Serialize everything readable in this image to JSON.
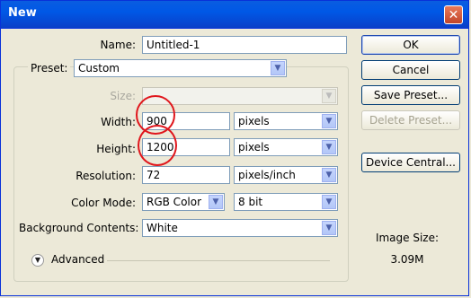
{
  "window": {
    "title": "New"
  },
  "form": {
    "name_label": "Name:",
    "name_value": "Untitled-1",
    "preset_label": "Preset:",
    "preset_value": "Custom",
    "size_label": "Size:",
    "width_label": "Width:",
    "width_value": "900",
    "width_unit": "pixels",
    "height_label": "Height:",
    "height_value": "1200",
    "height_unit": "pixels",
    "resolution_label": "Resolution:",
    "resolution_value": "72",
    "resolution_unit": "pixels/inch",
    "color_mode_label": "Color Mode:",
    "color_mode_value": "RGB Color",
    "bit_depth_value": "8 bit",
    "background_label": "Background Contents:",
    "background_value": "White",
    "advanced_label": "Advanced"
  },
  "buttons": {
    "ok": "OK",
    "cancel": "Cancel",
    "save_preset": "Save Preset...",
    "delete_preset": "Delete Preset...",
    "device_central": "Device Central..."
  },
  "image_size": {
    "label": "Image Size:",
    "value": "3.09M"
  },
  "colors": {
    "titlebar": "#0058e6",
    "annotation": "#e0161c",
    "dialog_bg": "#ece9d8"
  }
}
